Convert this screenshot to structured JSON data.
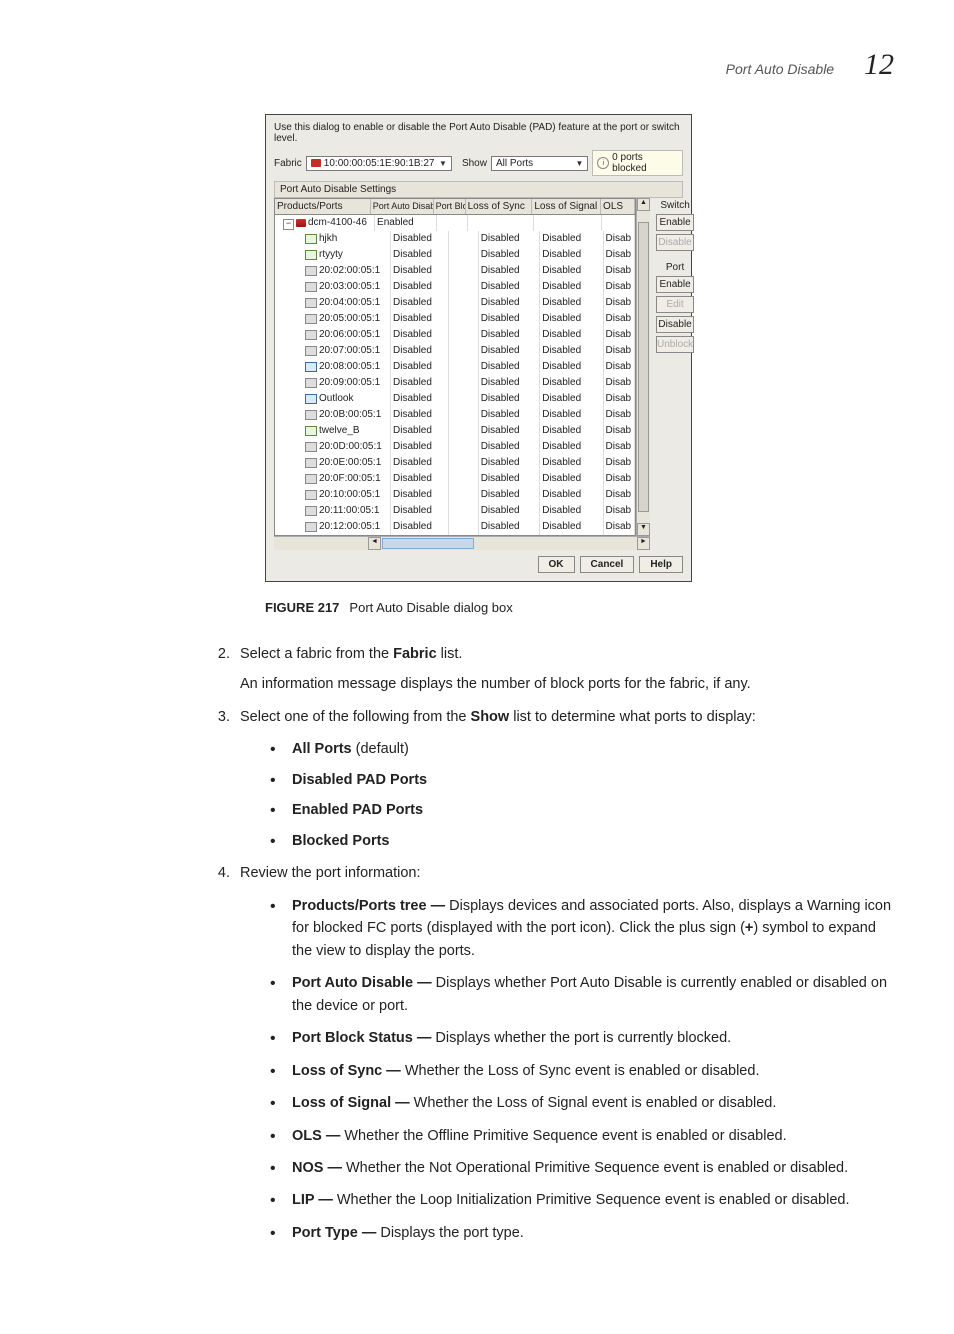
{
  "header": {
    "title": "Port Auto Disable",
    "chapter": "12"
  },
  "dialog": {
    "intro": "Use this dialog to enable or disable the Port Auto Disable (PAD) feature at the port or switch level.",
    "fabric_label": "Fabric",
    "fabric_value": "10:00:00:05:1E:90:1B:27",
    "show_label": "Show",
    "show_value": "All Ports",
    "badge": "0 ports blocked",
    "group_title": "Port Auto Disable Settings",
    "cols": {
      "prod": "Products/Ports",
      "pad": "Port Auto Disable",
      "blk": "Port Block Status",
      "sync": "Loss of Sync",
      "sig": "Loss of Signal",
      "ols": "OLS"
    },
    "device": {
      "name": "dcm-4100-46",
      "pad": "Enabled"
    },
    "rows": [
      {
        "cls": "pt-a",
        "name": "hjkh",
        "pad": "Disabled",
        "sync": "Disabled",
        "sig": "Disabled",
        "ols": "Disab"
      },
      {
        "cls": "pt-a",
        "name": "rtyyty",
        "pad": "Disabled",
        "sync": "Disabled",
        "sig": "Disabled",
        "ols": "Disab"
      },
      {
        "cls": "pt-b",
        "name": "20:02:00:05:1",
        "pad": "Disabled",
        "sync": "Disabled",
        "sig": "Disabled",
        "ols": "Disab"
      },
      {
        "cls": "pt-b",
        "name": "20:03:00:05:1",
        "pad": "Disabled",
        "sync": "Disabled",
        "sig": "Disabled",
        "ols": "Disab"
      },
      {
        "cls": "pt-b",
        "name": "20:04:00:05:1",
        "pad": "Disabled",
        "sync": "Disabled",
        "sig": "Disabled",
        "ols": "Disab"
      },
      {
        "cls": "pt-b",
        "name": "20:05:00:05:1",
        "pad": "Disabled",
        "sync": "Disabled",
        "sig": "Disabled",
        "ols": "Disab"
      },
      {
        "cls": "pt-b",
        "name": "20:06:00:05:1",
        "pad": "Disabled",
        "sync": "Disabled",
        "sig": "Disabled",
        "ols": "Disab"
      },
      {
        "cls": "pt-b",
        "name": "20:07:00:05:1",
        "pad": "Disabled",
        "sync": "Disabled",
        "sig": "Disabled",
        "ols": "Disab"
      },
      {
        "cls": "pt-c",
        "name": "20:08:00:05:1",
        "pad": "Disabled",
        "sync": "Disabled",
        "sig": "Disabled",
        "ols": "Disab"
      },
      {
        "cls": "pt-b",
        "name": "20:09:00:05:1",
        "pad": "Disabled",
        "sync": "Disabled",
        "sig": "Disabled",
        "ols": "Disab"
      },
      {
        "cls": "pt-c",
        "name": "Outlook",
        "pad": "Disabled",
        "sync": "Disabled",
        "sig": "Disabled",
        "ols": "Disab"
      },
      {
        "cls": "pt-b",
        "name": "20:0B:00:05:1",
        "pad": "Disabled",
        "sync": "Disabled",
        "sig": "Disabled",
        "ols": "Disab"
      },
      {
        "cls": "pt-a",
        "name": "twelve_B",
        "pad": "Disabled",
        "sync": "Disabled",
        "sig": "Disabled",
        "ols": "Disab"
      },
      {
        "cls": "pt-b",
        "name": "20:0D:00:05:1",
        "pad": "Disabled",
        "sync": "Disabled",
        "sig": "Disabled",
        "ols": "Disab"
      },
      {
        "cls": "pt-b",
        "name": "20:0E:00:05:1",
        "pad": "Disabled",
        "sync": "Disabled",
        "sig": "Disabled",
        "ols": "Disab"
      },
      {
        "cls": "pt-b",
        "name": "20:0F:00:05:1",
        "pad": "Disabled",
        "sync": "Disabled",
        "sig": "Disabled",
        "ols": "Disab"
      },
      {
        "cls": "pt-b",
        "name": "20:10:00:05:1",
        "pad": "Disabled",
        "sync": "Disabled",
        "sig": "Disabled",
        "ols": "Disab"
      },
      {
        "cls": "pt-b",
        "name": "20:11:00:05:1",
        "pad": "Disabled",
        "sync": "Disabled",
        "sig": "Disabled",
        "ols": "Disab"
      },
      {
        "cls": "pt-b",
        "name": "20:12:00:05:1",
        "pad": "Disabled",
        "sync": "Disabled",
        "sig": "Disabled",
        "ols": "Disab"
      }
    ],
    "side": {
      "switch_label": "Switch",
      "switch_enable": "Enable",
      "switch_disable": "Disable",
      "port_label": "Port",
      "port_enable": "Enable",
      "port_edit": "Edit",
      "port_disable": "Disable",
      "port_unblock": "Unblock"
    },
    "footer": {
      "ok": "OK",
      "cancel": "Cancel",
      "help": "Help"
    }
  },
  "figure": {
    "num": "FIGURE 217",
    "caption": "Port Auto Disable dialog box"
  },
  "steps": {
    "s2a": "Select a fabric from the ",
    "s2b": "Fabric",
    "s2c": " list.",
    "s2_note": "An information message displays the number of block ports for the fabric, if any.",
    "s3a": "Select one of the following from the ",
    "s3b": "Show",
    "s3c": " list to determine what ports to display:",
    "s3_opts": {
      "o1a": "All Ports",
      "o1b": " (default)",
      "o2": "Disabled PAD Ports",
      "o3": "Enabled PAD Ports",
      "o4": "Blocked Ports"
    },
    "s4": "Review the port information:",
    "s4_items": {
      "i1a": "Products/Ports tree — ",
      "i1b": "Displays devices and associated ports. Also, displays a Warning icon for blocked FC ports (displayed with the port icon). Click the plus sign (",
      "i1c": "+",
      "i1d": ") symbol to expand the view to display the ports.",
      "i2a": "Port Auto Disable — ",
      "i2b": "Displays whether Port Auto Disable is currently enabled or disabled on the device or port.",
      "i3a": "Port Block Status — ",
      "i3b": "Displays whether the port is currently blocked.",
      "i4a": "Loss of Sync — ",
      "i4b": "Whether the Loss of Sync event is enabled or disabled.",
      "i5a": "Loss of Signal — ",
      "i5b": "Whether the Loss of Signal event is enabled or disabled.",
      "i6a": "OLS — ",
      "i6b": "Whether the Offline Primitive Sequence event is enabled or disabled.",
      "i7a": "NOS — ",
      "i7b": "Whether the Not Operational Primitive Sequence event is enabled or disabled.",
      "i8a": "LIP — ",
      "i8b": "Whether the Loop Initialization Primitive Sequence event is enabled or disabled.",
      "i9a": "Port Type — ",
      "i9b": "Displays the port type."
    }
  }
}
